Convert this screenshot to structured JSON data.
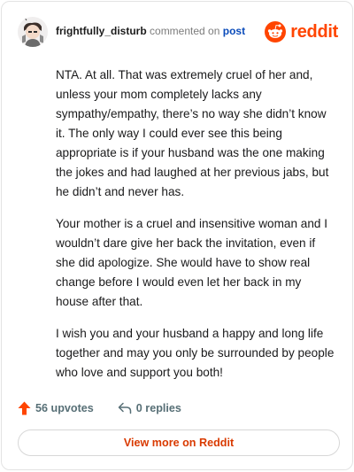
{
  "header": {
    "username": "frightfully_disturb",
    "action_text": "commented on",
    "post_link": "post",
    "brand": "reddit"
  },
  "comment": {
    "paragraphs": [
      "NTA. At all. That was extremely cruel of her and, unless your mom completely lacks any sympathy/empathy, there’s no way she didn’t know it. The only way I could ever see this being appropriate is if your husband was the one making the jokes and had laughed at her previous jabs, but he didn’t and never has.",
      "Your mother is a cruel and insensitive woman and I wouldn’t dare give her back the invitation, even if she did apologize. She would have to show real change before I would even let her back in my house after that.",
      "I wish you and your husband a happy and long life together and may you only be surrounded by people who love and support you both!"
    ]
  },
  "actions": {
    "upvotes": "56 upvotes",
    "replies": "0 replies"
  },
  "footer": {
    "view_more": "View more on Reddit"
  },
  "colors": {
    "brand": "#ff4500",
    "link": "#0a4bba",
    "view_more": "#d93a00"
  },
  "icons": [
    "avatar",
    "reddit-logo-icon",
    "upvote-arrow-icon",
    "reply-icon"
  ]
}
